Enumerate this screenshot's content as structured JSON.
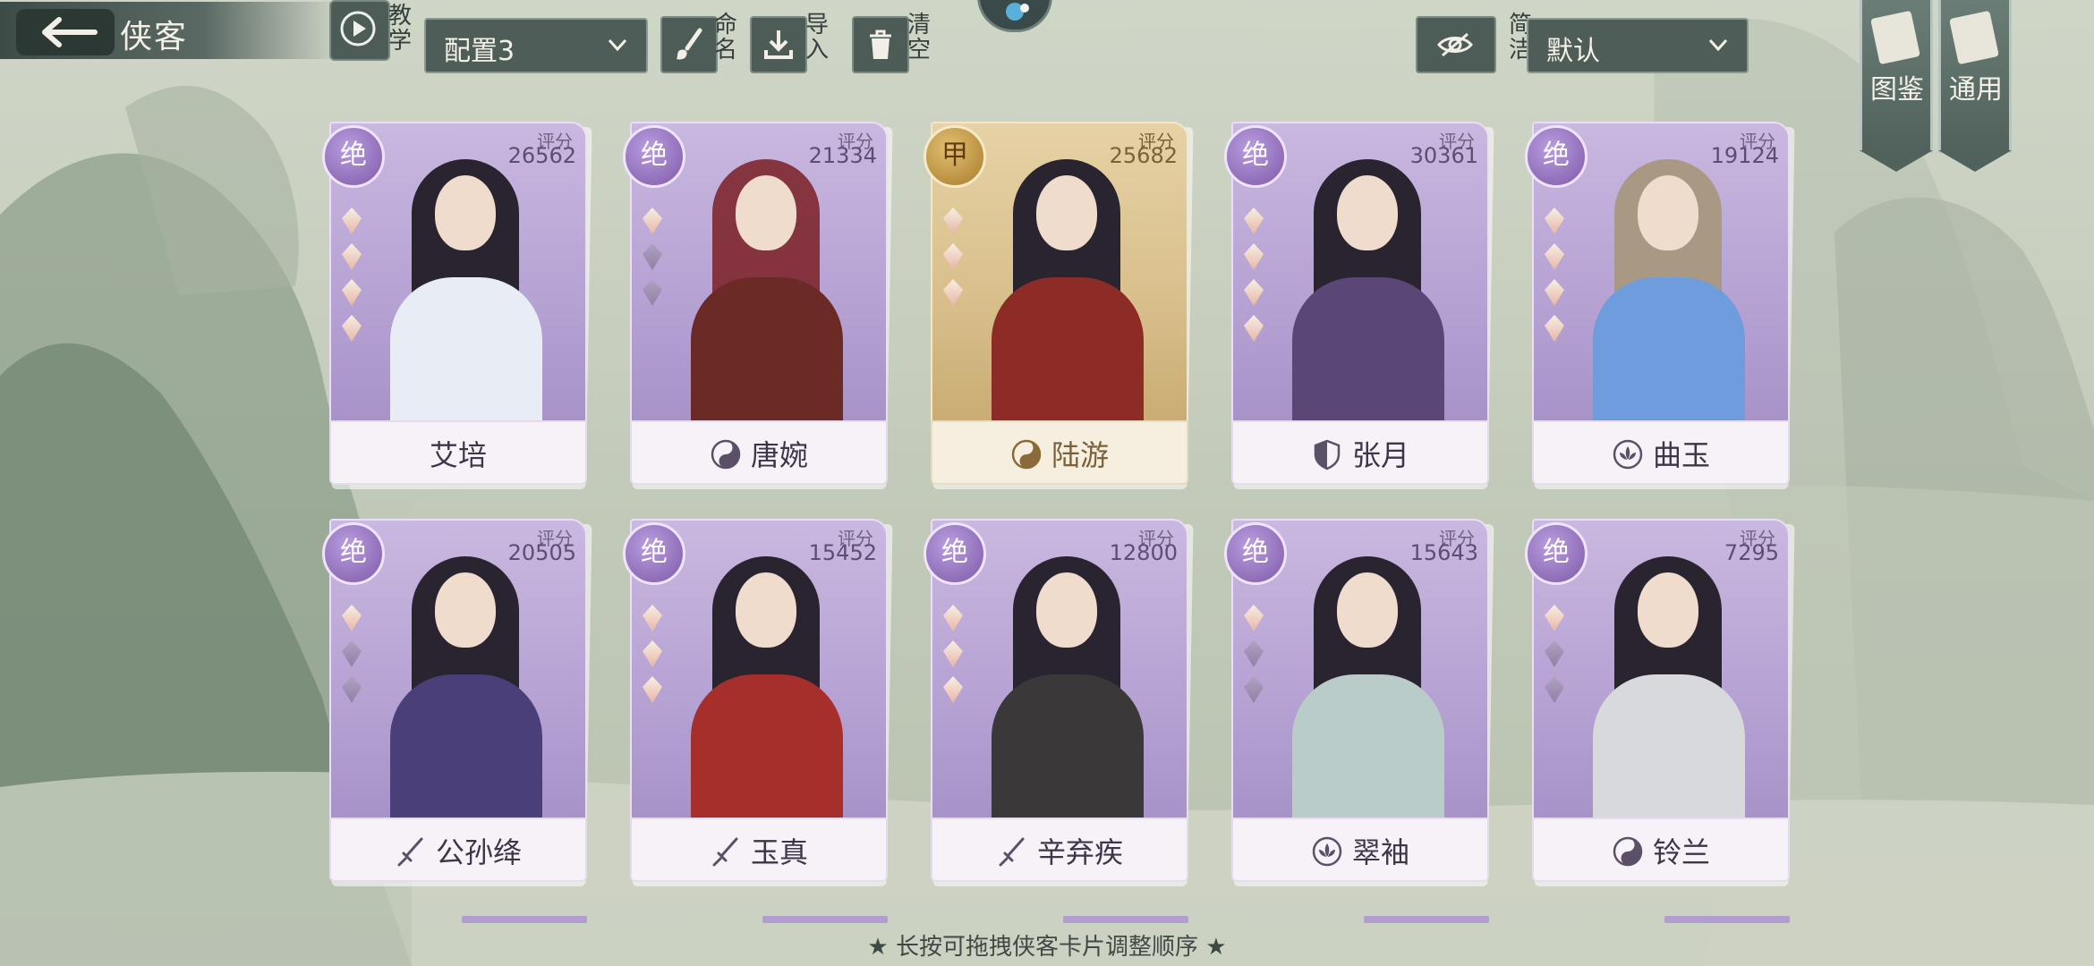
{
  "header": {
    "title": "侠客",
    "tutorial_label": "教学",
    "config_select": "配置3",
    "rename_label": "命名",
    "import_label": "导入",
    "clear_label": "清空",
    "simple_label": "简洁",
    "sort_select": "默认",
    "codex_label": "图鉴",
    "general_label": "通用"
  },
  "cards": [
    {
      "name": "艾培",
      "score_label": "评分",
      "score": "26562",
      "tier": "绝",
      "style": "purple",
      "element": ""
    },
    {
      "name": "唐婉",
      "score_label": "评分",
      "score": "21334",
      "tier": "绝",
      "style": "purple",
      "element": "yin-yang"
    },
    {
      "name": "陆游",
      "score_label": "评分",
      "score": "25682",
      "tier": "甲",
      "style": "gold",
      "element": "yin-yang"
    },
    {
      "name": "张月",
      "score_label": "评分",
      "score": "30361",
      "tier": "绝",
      "style": "purple",
      "element": "shield"
    },
    {
      "name": "曲玉",
      "score_label": "评分",
      "score": "19124",
      "tier": "绝",
      "style": "purple",
      "element": "lotus"
    },
    {
      "name": "公孙绛",
      "score_label": "评分",
      "score": "20505",
      "tier": "绝",
      "style": "purple",
      "element": "sword"
    },
    {
      "name": "玉真",
      "score_label": "评分",
      "score": "15452",
      "tier": "绝",
      "style": "purple",
      "element": "sword"
    },
    {
      "name": "辛弃疾",
      "score_label": "评分",
      "score": "12800",
      "tier": "绝",
      "style": "purple",
      "element": "sword"
    },
    {
      "name": "翠袖",
      "score_label": "评分",
      "score": "15643",
      "tier": "绝",
      "style": "purple",
      "element": "lotus"
    },
    {
      "name": "铃兰",
      "score_label": "评分",
      "score": "7295",
      "tier": "绝",
      "style": "purple",
      "element": "yin-yang"
    }
  ],
  "footer": {
    "hint": "★ 长按可拖拽侠客卡片调整顺序 ★"
  },
  "colors": {
    "accent_purple": "#9f86c7",
    "accent_gold": "#d6b57a",
    "toolbar": "#4f5d59"
  }
}
